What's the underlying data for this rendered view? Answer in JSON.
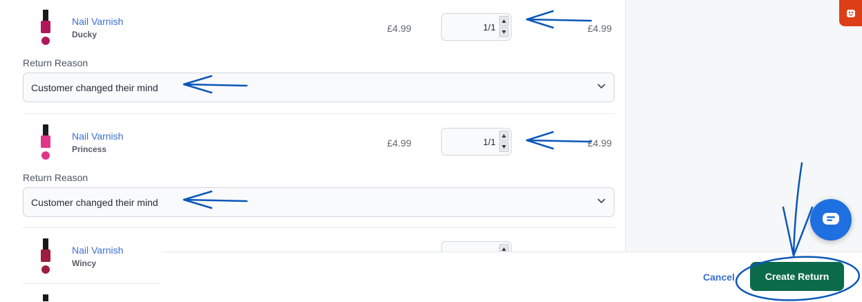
{
  "return_reason_label": "Return Reason",
  "items": [
    {
      "name": "Nail Varnish",
      "variant": "Ducky",
      "unit_price": "£4.99",
      "quantity": "1/1",
      "line_total": "£4.99",
      "return_reason": "Customer changed their mind",
      "bottle_color": "#b0175a"
    },
    {
      "name": "Nail Varnish",
      "variant": "Princess",
      "unit_price": "£4.99",
      "quantity": "1/1",
      "line_total": "£4.99",
      "return_reason": "Customer changed their mind",
      "bottle_color": "#e0368a"
    },
    {
      "name": "Nail Varnish",
      "variant": "Wincy",
      "bottle_color": "#9e1c3c"
    }
  ],
  "footer": {
    "cancel_label": "Cancel",
    "create_label": "Create Return"
  },
  "colors": {
    "primary": "#0b6b4b",
    "link": "#3b6fd1",
    "chat": "#1e6fe0",
    "badge": "#dd3e17",
    "annotation": "#0a56b8"
  },
  "icons": [
    "nail-varnish-bottle-icon",
    "spinner-up-icon",
    "spinner-down-icon",
    "chevron-down-icon",
    "chat-icon",
    "app-badge-icon"
  ]
}
